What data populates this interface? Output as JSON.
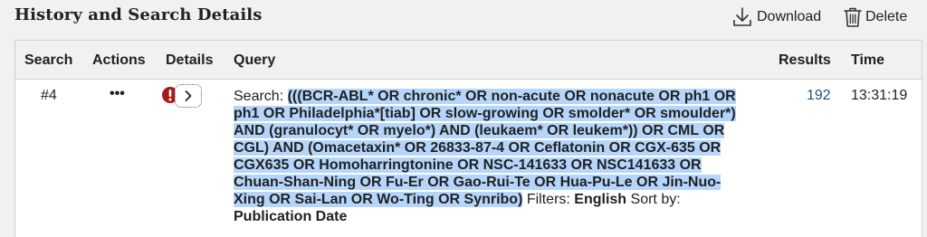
{
  "header": {
    "title": "History and Search Details",
    "download_label": "Download",
    "delete_label": "Delete"
  },
  "table": {
    "columns": [
      "Search",
      "Actions",
      "Details",
      "Query",
      "Results",
      "Time"
    ],
    "rows": [
      {
        "number": "#4",
        "actions": "•••",
        "query_prefix": "Search: ",
        "query": "(((BCR-ABL* OR chronic* OR non-acute OR nonacute OR ph1 OR ph1 OR Philadelphia*[tiab] OR slow-growing OR smolder* OR smoulder*) AND (granulocyt* OR myelo*) AND (leukaem* OR leukem*)) OR CML OR CGL) AND (Omacetaxin* OR 26833-87-4 OR Ceflatonin OR CGX-635 OR CGX635 OR Homoharringtonine OR NSC-141633 OR NSC141633 OR Chuan-Shan-Ning OR Fu-Er OR Gao-Rui-Te OR Hua-Pu-Le OR Jin-Nuo-Xing OR Sai-Lan OR Wo-Ting OR Synribo)",
        "filters_label": " Filters: ",
        "filters_value": "English",
        "sort_label": " Sort by: ",
        "sort_value": "Publication Date",
        "results": "192",
        "time": "13:31:19"
      }
    ]
  },
  "colors": {
    "selection_highlight": "#b5d5fb",
    "link": "#20558a",
    "alert": "#a51b1b"
  },
  "icons": [
    "download-icon",
    "trash-icon",
    "alert-icon",
    "chevron-right-icon"
  ]
}
